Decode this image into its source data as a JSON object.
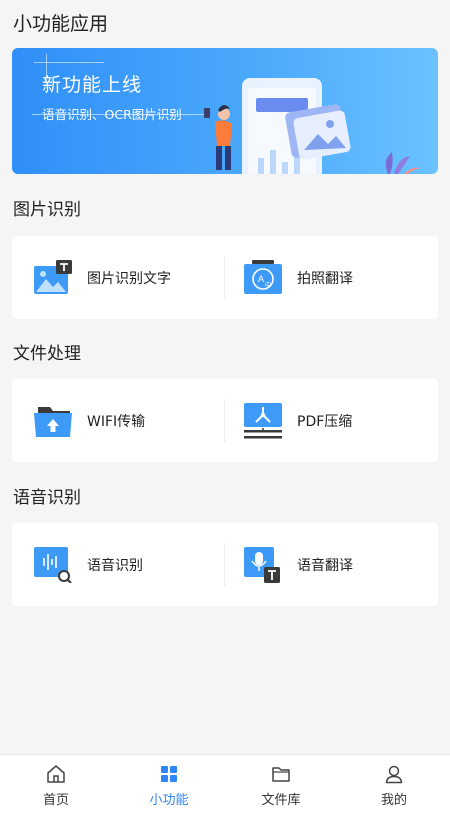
{
  "page": {
    "title": "小功能应用"
  },
  "banner": {
    "title": "新功能上线",
    "subtitle": "语音识别、OCR图片识别"
  },
  "sections": [
    {
      "title": "图片识别",
      "items": [
        {
          "label": "图片识别文字",
          "icon": "image-text-icon"
        },
        {
          "label": "拍照翻译",
          "icon": "camera-translate-icon"
        }
      ]
    },
    {
      "title": "文件处理",
      "items": [
        {
          "label": "WIFI传输",
          "icon": "folder-upload-icon"
        },
        {
          "label": "PDF压缩",
          "icon": "pdf-compress-icon"
        }
      ]
    },
    {
      "title": "语音识别",
      "items": [
        {
          "label": "语音识别",
          "icon": "voice-search-icon"
        },
        {
          "label": "语音翻译",
          "icon": "microphone-text-icon"
        }
      ]
    }
  ],
  "tabbar": {
    "items": [
      {
        "label": "首页",
        "icon": "home-icon"
      },
      {
        "label": "小功能",
        "icon": "grid-icon",
        "active": true
      },
      {
        "label": "文件库",
        "icon": "folder-icon"
      },
      {
        "label": "我的",
        "icon": "user-icon"
      }
    ]
  },
  "colors": {
    "accent": "#2f86f6",
    "icon_blue": "#3d9bf7",
    "icon_dark": "#3a3a3a"
  }
}
